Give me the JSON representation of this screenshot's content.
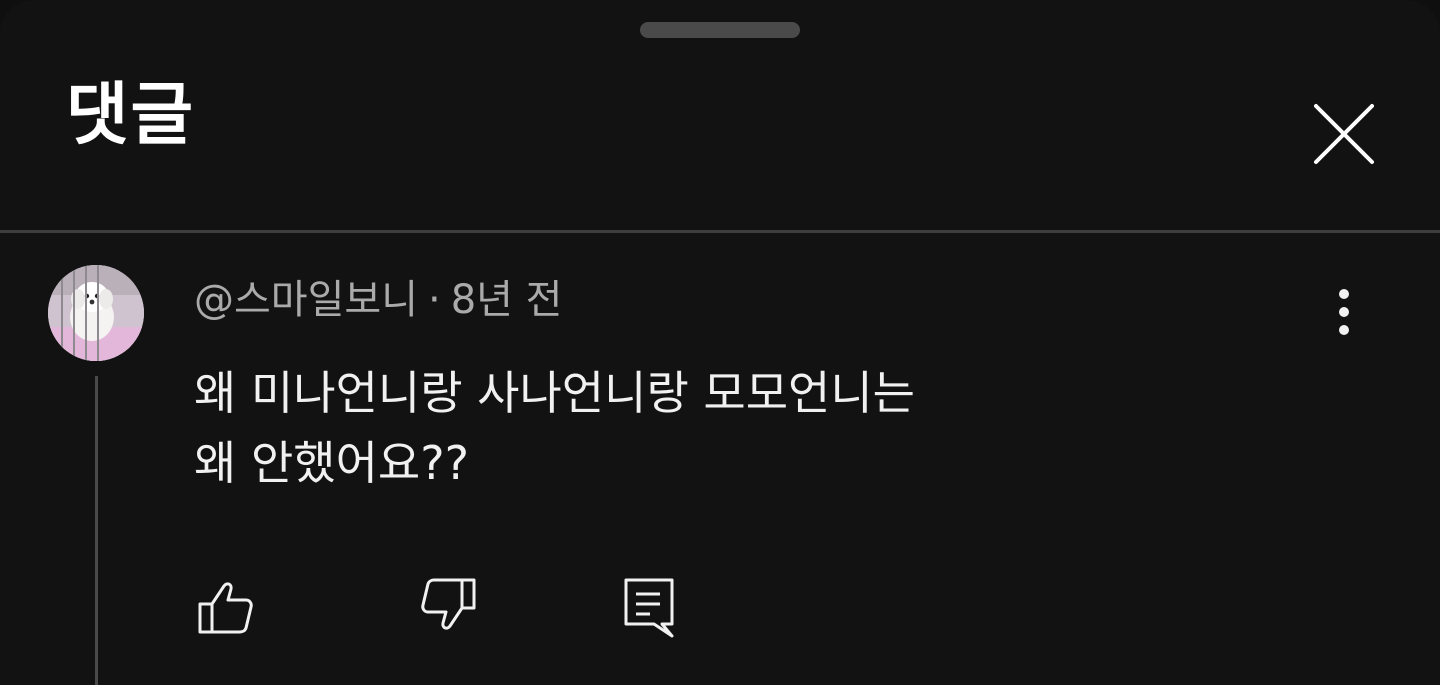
{
  "sheet": {
    "title": "댓글"
  },
  "icons": {
    "close": "close-icon",
    "more": "more-vertical-icon",
    "like": "thumbs-up-icon",
    "dislike": "thumbs-down-icon",
    "reply": "reply-comment-icon"
  },
  "comment": {
    "author": "@스마일보니",
    "separator": "·",
    "time": "8년 전",
    "text_lines": [
      "왜 미나언니랑 사나언니랑 모모언니는",
      "왜 안했어요??"
    ]
  },
  "colors": {
    "background": "#121212",
    "text_primary": "#f1f1f1",
    "text_secondary": "#aaaaaa",
    "divider": "#3d3d3d"
  }
}
